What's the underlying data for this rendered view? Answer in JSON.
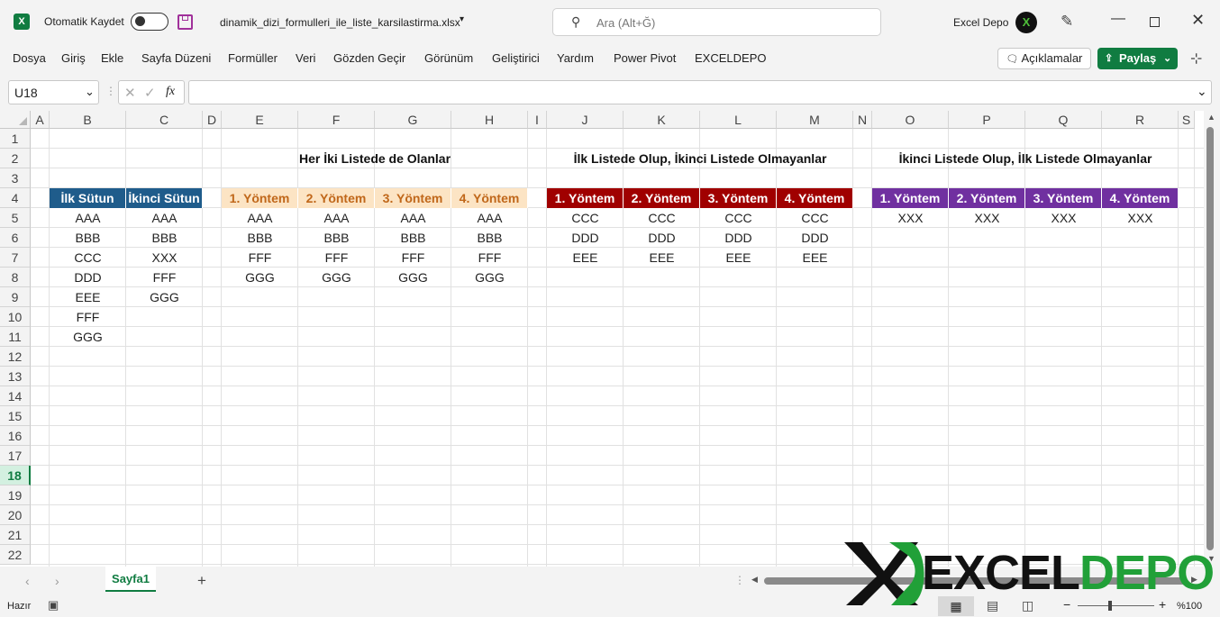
{
  "titlebar": {
    "autosave_label": "Otomatik Kaydet",
    "filename": "dinamik_dizi_formulleri_ile_liste_karsilastirma.xlsx",
    "search_placeholder": "Ara (Alt+Ğ)",
    "user_name": "Excel Depo",
    "avatar_letter": "X"
  },
  "ribbon": {
    "menu": [
      "Dosya",
      "Giriş",
      "Ekle",
      "Sayfa Düzeni",
      "Formüller",
      "Veri",
      "Gözden Geçir",
      "Görünüm",
      "Geliştirici",
      "Yardım",
      "Power Pivot",
      "EXCELDEPO"
    ],
    "comments_label": "Açıklamalar",
    "share_label": "Paylaş"
  },
  "formula_bar": {
    "name_box": "U18",
    "fx": "fx",
    "value": ""
  },
  "columns": [
    "A",
    "B",
    "C",
    "D",
    "E",
    "F",
    "G",
    "H",
    "I",
    "J",
    "K",
    "L",
    "M",
    "N",
    "O",
    "P",
    "Q",
    "R",
    "S"
  ],
  "rows": [
    "1",
    "2",
    "3",
    "4",
    "5",
    "6",
    "7",
    "8",
    "9",
    "10",
    "11",
    "12",
    "13",
    "14",
    "15",
    "16",
    "17",
    "18",
    "19",
    "20",
    "21",
    "22"
  ],
  "selected_row": "18",
  "sheet": {
    "section_titles": {
      "both": "Her İki Listede de Olanlar",
      "first_only": "İlk Listede Olup, İkinci Listede Olmayanlar",
      "second_only": "İkinci Listede Olup, İlk Listede Olmayanlar"
    },
    "source_headers": [
      "İlk Sütun",
      "İkinci Sütun"
    ],
    "method_headers": [
      "1. Yöntem",
      "2. Yöntem",
      "3. Yöntem",
      "4. Yöntem"
    ],
    "first_list": [
      "AAA",
      "BBB",
      "CCC",
      "DDD",
      "EEE",
      "FFF",
      "GGG"
    ],
    "second_list": [
      "AAA",
      "BBB",
      "XXX",
      "FFF",
      "GGG"
    ],
    "both_results": [
      "AAA",
      "BBB",
      "FFF",
      "GGG"
    ],
    "first_only_results": [
      "CCC",
      "DDD",
      "EEE"
    ],
    "second_only_results": [
      "XXX"
    ]
  },
  "colors": {
    "source_header_bg": "#1f5c8b",
    "both_header_bg": "#fce4c4",
    "first_only_header_bg": "#a00000",
    "second_only_header_bg": "#7030a0",
    "excel_green": "#107c41"
  },
  "tabs": {
    "active": "Sayfa1"
  },
  "status": {
    "ready": "Hazır",
    "zoom": "%100"
  },
  "watermark": "EXCELDEPO"
}
